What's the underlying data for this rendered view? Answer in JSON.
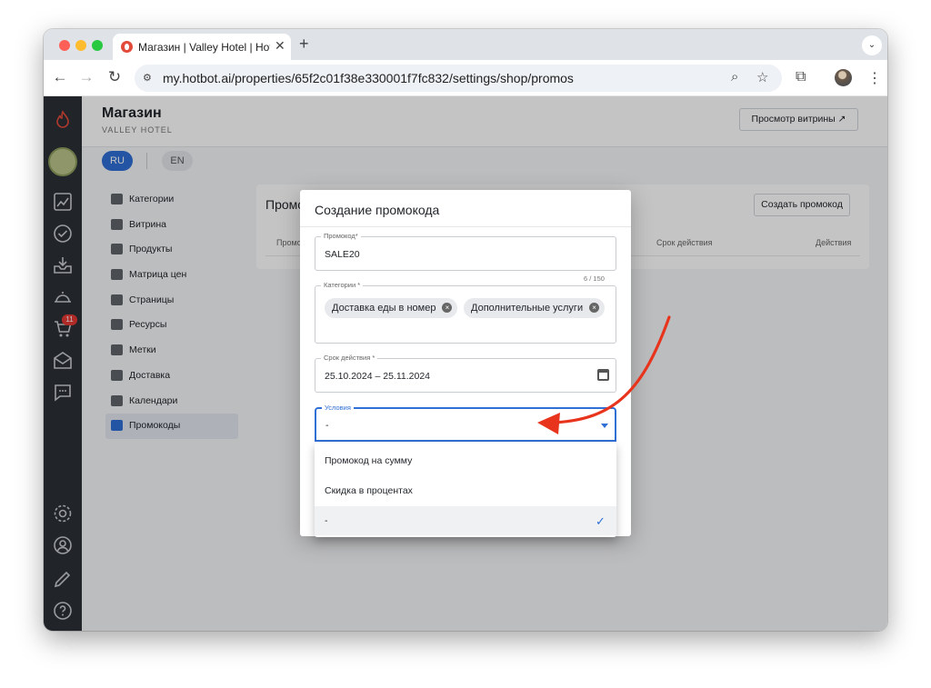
{
  "browser": {
    "tab_title": "Магазин | Valley Hotel | Hotbot",
    "url": "my.hotbot.ai/properties/65f2c01f38e330001f7fc832/settings/shop/promos"
  },
  "header": {
    "title": "Магазин",
    "subtitle": "VALLEY HOTEL",
    "showcase_button": "Просмотр витрины ↗"
  },
  "languages": {
    "ru": "RU",
    "en": "EN"
  },
  "sidebar": {
    "cart_badge": "11"
  },
  "subnav": {
    "items": [
      {
        "label": "Категории"
      },
      {
        "label": "Витрина"
      },
      {
        "label": "Продукты"
      },
      {
        "label": "Матрица цен"
      },
      {
        "label": "Страницы"
      },
      {
        "label": "Ресурсы"
      },
      {
        "label": "Метки"
      },
      {
        "label": "Доставка"
      },
      {
        "label": "Календари"
      },
      {
        "label": "Промокоды"
      }
    ],
    "active_index": 9
  },
  "content": {
    "title": "Промо",
    "create_button": "Создать промокод",
    "columns": [
      "Промо",
      "Срок действия",
      "Действия"
    ]
  },
  "modal": {
    "title": "Создание промокода",
    "promo_label": "Промокод*",
    "promo_value": "SALE20",
    "promo_counter": "6 / 150",
    "categories_label": "Категории *",
    "categories": [
      "Доставка еды в номер",
      "Дополнительные услуги"
    ],
    "period_label": "Срок действия *",
    "period_value": "25.10.2024 – 25.11.2024",
    "conditions_label": "Условия",
    "conditions_value": "-"
  },
  "dropdown": {
    "options": [
      "Промокод на сумму",
      "Скидка в процентах",
      "-"
    ],
    "selected_index": 2
  },
  "colors": {
    "accent": "#2f6fd6",
    "annotation_arrow": "#e8341c",
    "rail": "#2b2f36"
  }
}
